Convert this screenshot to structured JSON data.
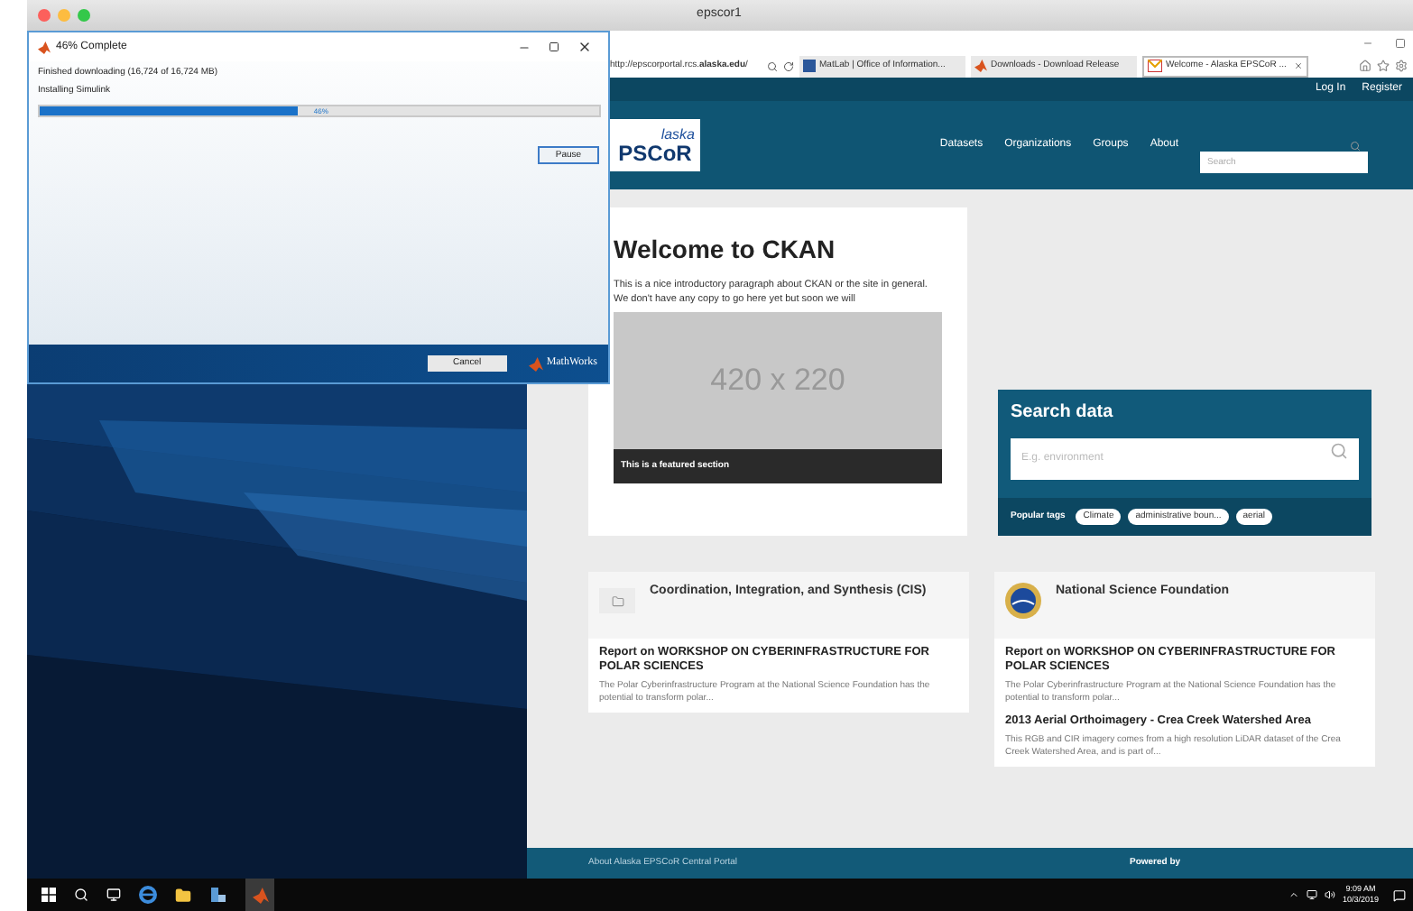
{
  "host_window": {
    "title": "epscor1"
  },
  "browser": {
    "address": "http://epscorportal.rcs.**alaska.edu**/",
    "tabs": [
      {
        "label": "MatLab | Office of Information...",
        "selected": false,
        "kind": "square"
      },
      {
        "label": "Downloads - Download Release",
        "selected": false,
        "kind": "matlab"
      },
      {
        "label": "Welcome - Alaska EPSCoR ...",
        "selected": true,
        "kind": "mail"
      }
    ]
  },
  "site": {
    "top_links": [
      "Log In",
      "Register"
    ],
    "logo": {
      "word": "laska",
      "mark": "PSCoR"
    },
    "nav": [
      "Datasets",
      "Organizations",
      "Groups",
      "About"
    ],
    "search": {
      "placeholder": "Search"
    },
    "welcome": {
      "title": "Welcome to CKAN",
      "text": "This is a nice introductory paragraph about CKAN or the site in general. We don't have any copy to go here yet but soon we will",
      "image_label": "420 x 220",
      "caption": "This is a featured section"
    },
    "search_data": {
      "title": "Search data",
      "placeholder": "E.g. environment",
      "tags_label": "Popular tags",
      "tags": [
        "Climate",
        "administrative boun...",
        "aerial"
      ]
    },
    "cards": [
      {
        "title": "Coordination, Integration, and Synthesis (CIS)",
        "kind": "folder",
        "items": [
          {
            "title": "Report on WORKSHOP ON CYBERINFRASTRUCTURE FOR POLAR SCIENCES",
            "text": "The Polar Cyberinfrastructure Program at the National Science Foundation has the potential to transform polar..."
          }
        ]
      },
      {
        "title": "National Science Foundation",
        "kind": "seal",
        "items": [
          {
            "title": "Report on WORKSHOP ON CYBERINFRASTRUCTURE FOR POLAR SCIENCES",
            "text": "The Polar Cyberinfrastructure Program at the National Science Foundation has the potential to transform polar..."
          },
          {
            "title": "2013 Aerial Orthoimagery - Crea Creek Watershed Area",
            "text": "This RGB and CIR imagery comes from a high resolution LiDAR dataset of the Crea Creek Watershed Area, and is part of..."
          }
        ]
      }
    ],
    "footer": [
      "About Alaska EPSCoR Central Portal",
      "Powered by"
    ]
  },
  "dialog": {
    "title": "46% Complete",
    "status": "Finished downloading (16,724 of 16,724 MB)",
    "step": "Installing Simulink",
    "progress": {
      "level": 0.46,
      "reading": "46%"
    },
    "pause": "Pause",
    "cancel": "Cancel",
    "brand": "MathWorks"
  },
  "taskbar": {
    "time": "9:09 AM",
    "date": "10/3/2019"
  }
}
